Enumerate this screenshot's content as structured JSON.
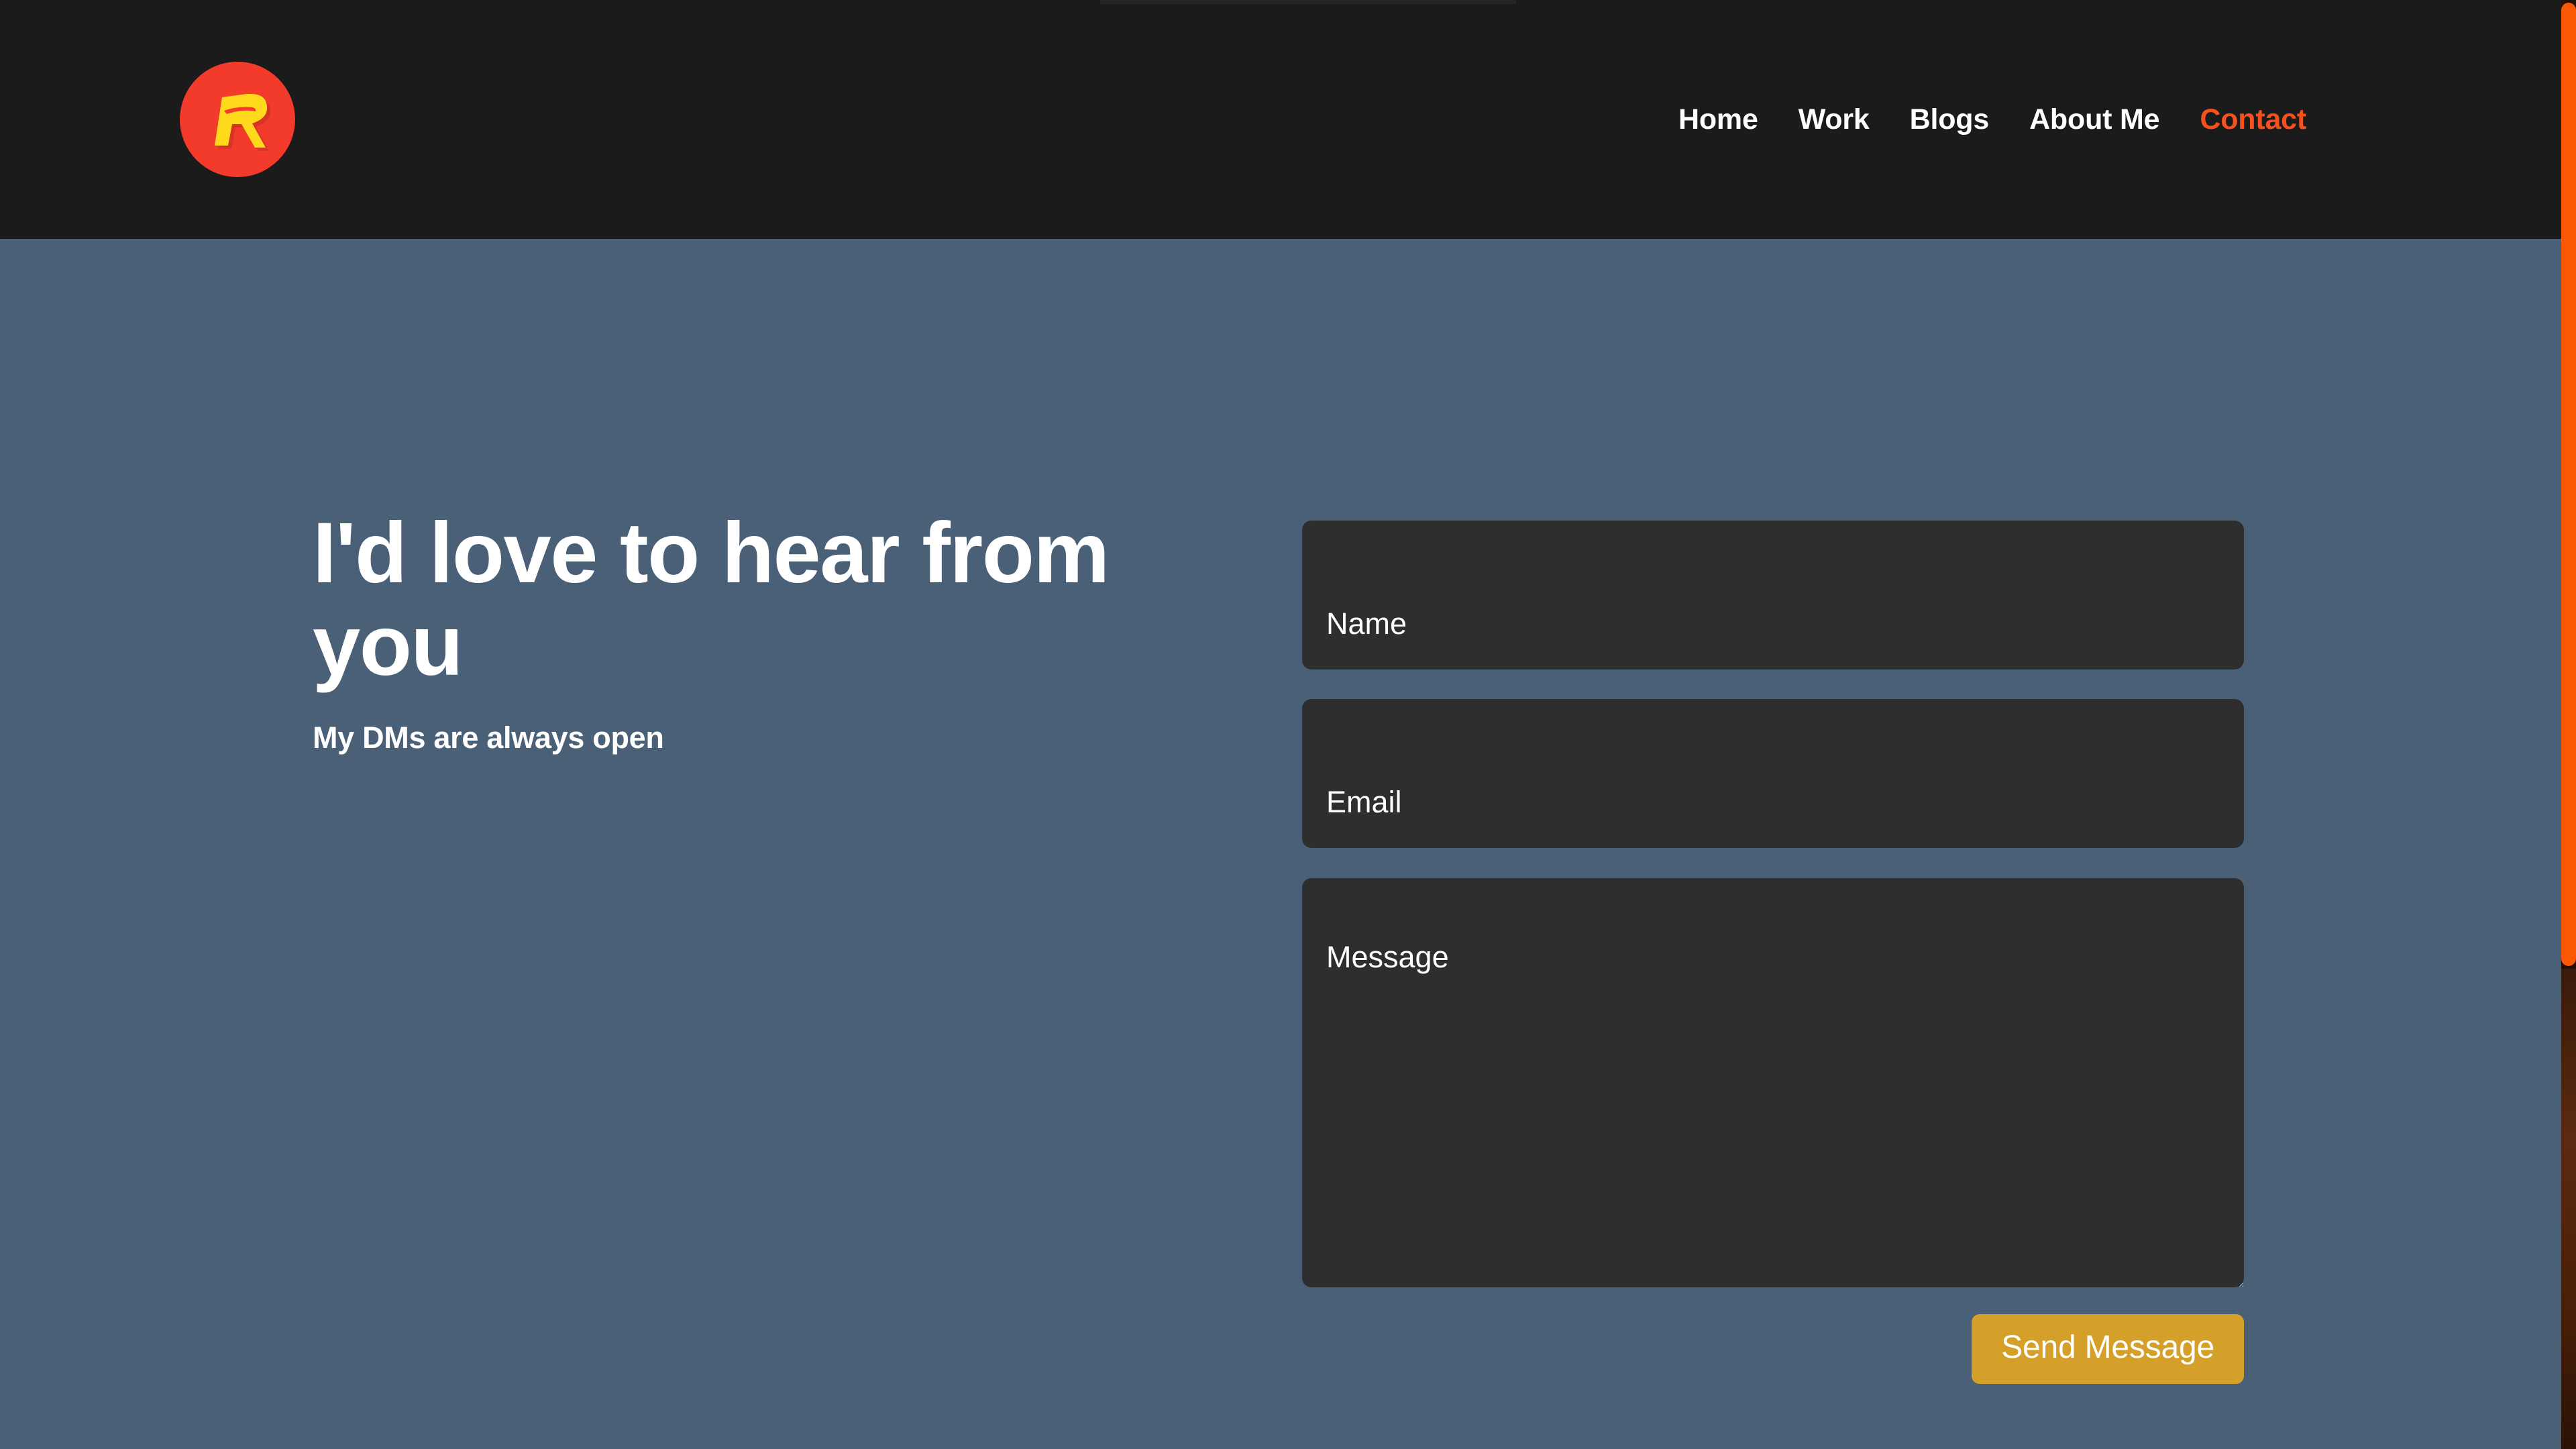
{
  "header": {
    "logo": {
      "icon": "robin-r-logo-icon",
      "circle_color": "#f23b2b",
      "letter_color": "#ffd91c",
      "letter": "R"
    },
    "nav": [
      {
        "label": "Home",
        "active": false
      },
      {
        "label": "Work",
        "active": false
      },
      {
        "label": "Blogs",
        "active": false
      },
      {
        "label": "About Me",
        "active": false
      },
      {
        "label": "Contact",
        "active": true
      }
    ],
    "background_color": "#1b1b1b",
    "active_link_color": "#f4511e"
  },
  "main": {
    "background_color": "#4a6077",
    "intro": {
      "heading": "I'd love to hear from you",
      "subheading": "My DMs are always open"
    },
    "form": {
      "name": {
        "placeholder": "Name",
        "value": ""
      },
      "email": {
        "placeholder": "Email",
        "value": ""
      },
      "message": {
        "placeholder": "Message",
        "value": ""
      },
      "submit_label": "Send Message",
      "submit_color": "#d4a02a",
      "field_background": "#2e2e2e"
    }
  },
  "scrollbar": {
    "thumb_color": "#fa5805",
    "track_color": "#241008",
    "position": "right"
  }
}
